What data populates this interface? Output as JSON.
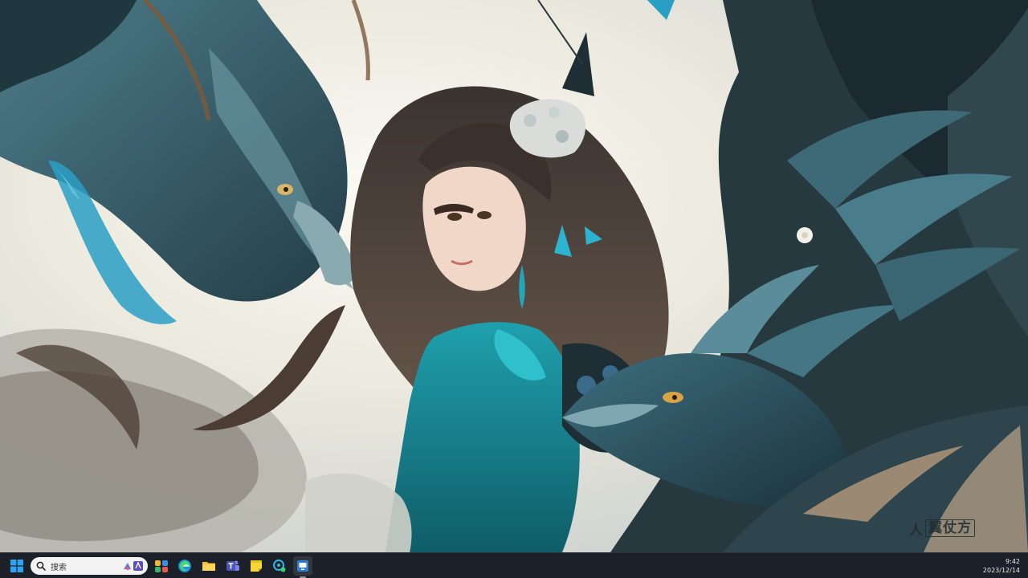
{
  "wallpaper": {
    "watermark_mark": "人",
    "watermark_text": "翼仗方"
  },
  "taskbar": {
    "search": {
      "placeholder": "搜索"
    },
    "icons": [
      {
        "name": "start-icon"
      },
      {
        "name": "widgets-icon"
      },
      {
        "name": "edge-icon"
      },
      {
        "name": "file-explorer-icon"
      },
      {
        "name": "teams-icon"
      },
      {
        "name": "sticky-notes-icon"
      },
      {
        "name": "chat-app-icon"
      },
      {
        "name": "active-app-icon"
      }
    ],
    "clock": {
      "time": "9:42",
      "date": "2023/12/14"
    }
  },
  "colors": {
    "taskbar_bg": "#1c2029",
    "accent_teal": "#1e8fa8",
    "start_blue": "#2ea3f2"
  }
}
